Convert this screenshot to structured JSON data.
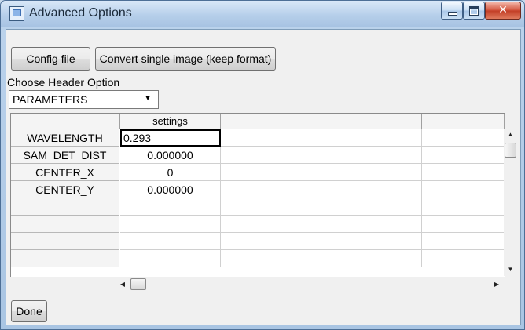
{
  "window": {
    "title": "Advanced Options"
  },
  "toolbar": {
    "config_label": "Config file",
    "convert_label": "Convert single image (keep format)"
  },
  "header_option": {
    "label": "Choose Header Option",
    "selected": "PARAMETERS"
  },
  "table": {
    "columns": [
      "settings",
      "",
      "",
      ""
    ],
    "rows": [
      {
        "label": "WAVELENGTH",
        "value": "0.293"
      },
      {
        "label": "SAM_DET_DIST",
        "value": "0.000000"
      },
      {
        "label": "CENTER_X",
        "value": "0"
      },
      {
        "label": "CENTER_Y",
        "value": "0.000000"
      },
      {
        "label": "",
        "value": ""
      },
      {
        "label": "",
        "value": ""
      },
      {
        "label": "",
        "value": ""
      },
      {
        "label": "",
        "value": ""
      }
    ]
  },
  "footer": {
    "done_label": "Done"
  },
  "colors": {
    "title_bar": "#b6cfea",
    "close_button": "#c23e26",
    "dialog_bg": "#f0f0f0"
  },
  "icons": {
    "app": "app-window-icon",
    "minimize": "minimize-icon",
    "maximize": "maximize-icon",
    "close": "close-icon"
  }
}
